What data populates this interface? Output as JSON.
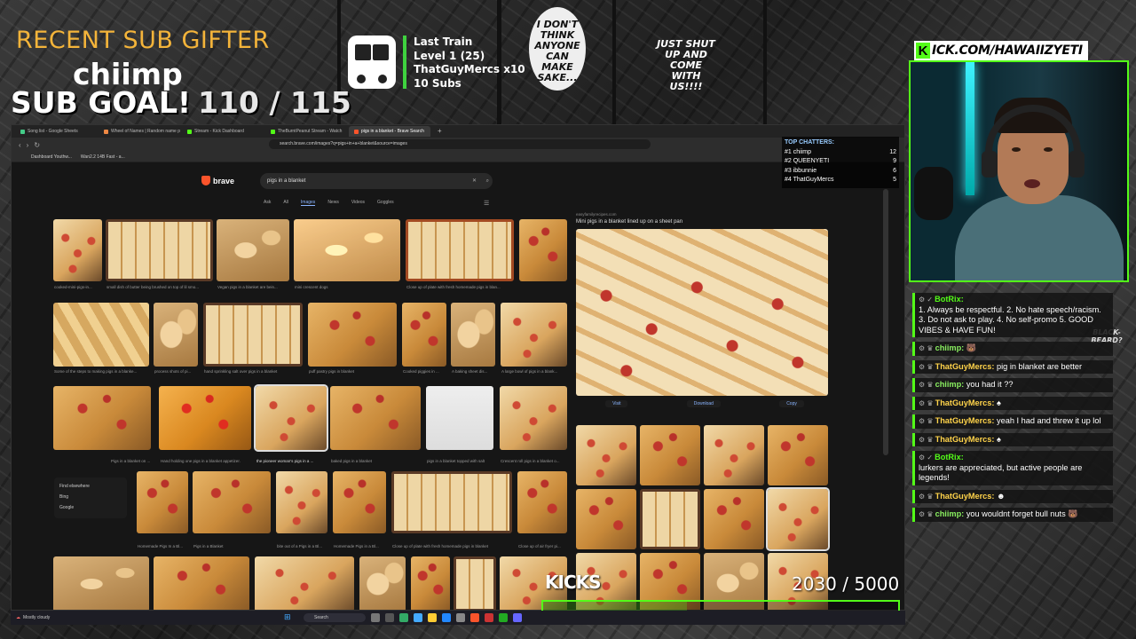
{
  "overlay": {
    "gifter_title": "RECENT SUB GIFTER",
    "gifter_name": "chiimp",
    "sub_goal_label": "SUB GOAL!",
    "sub_goal_value": "110 / 115",
    "train": {
      "title": "Last Train",
      "level": "Level 1  (25)",
      "top": "ThatGuyMercs x10",
      "subs": "10 Subs"
    },
    "kick_url": "ICK.COM/HAWAIIZYETI",
    "kick_letter": "K",
    "kicks_label": "KICKS",
    "kicks_count": "2030  / 5000",
    "kicks_progress": 0.406
  },
  "manga": {
    "bubble1": "I DON'T THINK ANYONE CAN MAKE SAKE...",
    "bubble2": "JUST SHUT UP AND COME WITH US!!!!",
    "bubble3": "BLACK-BEARD?"
  },
  "browser": {
    "tabs": [
      {
        "label": "Song list - Google Sheets",
        "active": false
      },
      {
        "label": "Wheel of Names | Random name pi",
        "active": false
      },
      {
        "label": "Stream - Kick Dashboard",
        "active": false
      },
      {
        "label": "TheBurntPeanut Stream - Watch",
        "active": false
      },
      {
        "label": "pigs in a blanket - Brave Search",
        "active": true
      }
    ],
    "new_tab": "+",
    "url": "search.brave.com/images?q=pigs+in+a+blanket&source=images",
    "bookmarks": [
      "Dashboard Youthw...",
      "Wan2.2 14B Fast - a..."
    ],
    "brand": "brave",
    "query": "pigs in a blanket",
    "search_tabs": [
      "Ask",
      "All",
      "Images",
      "News",
      "Videos",
      "Goggles"
    ],
    "active_search_tab": "Images",
    "results_row1": [
      "cooked-mini-pigs-in...",
      "small dish of butter being brushed on top of lil smo...",
      "Vegan pigs in a blanket are bein...",
      "mini crescent dogs",
      "Close up of plate with fresh homemade pigs in blan...",
      ""
    ],
    "results_row2": [
      "Some of the steps to making pigs in a blanke...",
      "process shots of pi...",
      "hand sprinkling salt over pigs in a blanket",
      "puff pastry pigs in blanket",
      "Cooked piggies in ...",
      "A baking sheet dis...",
      "A large bowl of pigs in a blank..."
    ],
    "results_row3": [
      "Pigs in a blanket on ...",
      "Hand holding one pigs in a blanket appetizer.",
      "the pioneer woman's pigs in a ...",
      "baked pigs in a blanket",
      "pigs in a blanket topped with salt",
      "Crescent roll pigs in a blanket o..."
    ],
    "results_row4": [
      "Homemade Pigs In a Bl...",
      "Pigs in a Blanket",
      "bite out of a Pigs in a Bl...",
      "Homemade Pigs in a Bl...",
      "Close up of plate with fresh homemade pigs in blanket",
      "Close up of air fryer pi..."
    ],
    "find_elsewhere": {
      "title": "Find elsewhere",
      "items": [
        "Bing",
        "Google"
      ]
    },
    "detail": {
      "source": "easyfamilyrecipes.com",
      "title": "Mini pigs in a blanket lined up on a sheet pan",
      "actions": [
        "Visit",
        "Download",
        "Copy"
      ]
    }
  },
  "top_chatters": {
    "title": "TOP CHATTERS:",
    "rows": [
      {
        "rank": "#1 chiimp",
        "count": "12"
      },
      {
        "rank": "#2 QUEENYETI",
        "count": "9"
      },
      {
        "rank": "#3 ibbunnie",
        "count": "6"
      },
      {
        "rank": "#4 ThatGuyMercs",
        "count": "5"
      }
    ]
  },
  "taskbar": {
    "weather": "Mostly cloudy",
    "search": "Search"
  },
  "chat": [
    {
      "user": "BotRix:",
      "style": "bot",
      "badges": "⚙ ✓",
      "text": "1. Always be respectful. 2. No hate speech/racism. 3. Do not ask to play. 4. No self-promo 5. GOOD VIBES & HAVE FUN!"
    },
    {
      "user": "chiimp:",
      "style": "green",
      "badges": "⚙ ♛",
      "text": "🐻"
    },
    {
      "user": "ThatGuyMercs:",
      "style": "yellow",
      "badges": "⚙ ♛",
      "text": "pig in blanket are better"
    },
    {
      "user": "chiimp:",
      "style": "green",
      "badges": "⚙ ♛",
      "text": "you had it ??"
    },
    {
      "user": "ThatGuyMercs:",
      "style": "yellow",
      "badges": "⚙ ♛",
      "text": "♠"
    },
    {
      "user": "ThatGuyMercs:",
      "style": "yellow",
      "badges": "⚙ ♛",
      "text": "yeah I had and threw it up lol"
    },
    {
      "user": "ThatGuyMercs:",
      "style": "yellow",
      "badges": "⚙ ♛",
      "text": "♠"
    },
    {
      "user": "BotRix:",
      "style": "bot",
      "badges": "⚙ ✓",
      "text": "lurkers are appreciated, but active people are legends!"
    },
    {
      "user": "ThatGuyMercs:",
      "style": "yellow",
      "badges": "⚙ ♛",
      "text": "☻"
    },
    {
      "user": "chiimp:",
      "style": "green",
      "badges": "⚙ ♛",
      "text": "you wouldnt forget bull nuts 🐻"
    }
  ],
  "colors": {
    "kick_green": "#53fc18",
    "gifter_gold": "#f4b43a",
    "brave_orange": "#fb542b",
    "link_blue": "#8ab4ff"
  }
}
